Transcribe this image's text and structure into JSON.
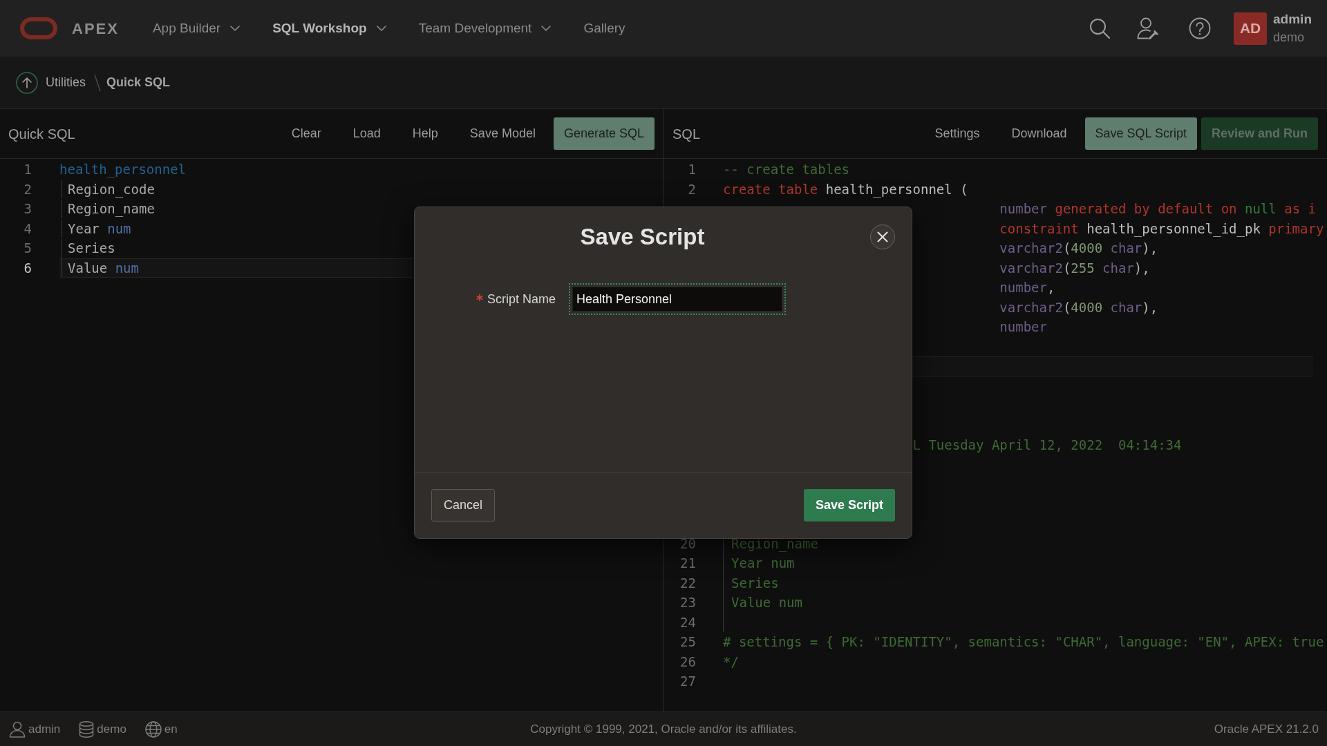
{
  "header": {
    "product": "APEX",
    "nav": [
      {
        "label": "App Builder",
        "selected": false,
        "menu": true
      },
      {
        "label": "SQL Workshop",
        "selected": true,
        "menu": true
      },
      {
        "label": "Team Development",
        "selected": false,
        "menu": true
      },
      {
        "label": "Gallery",
        "selected": false,
        "menu": false
      }
    ],
    "user": {
      "initials": "AD",
      "name": "admin",
      "workspace": "demo"
    }
  },
  "breadcrumb": [
    {
      "label": "Utilities",
      "current": false
    },
    {
      "label": "Quick SQL",
      "current": true
    }
  ],
  "quick_sql_panel": {
    "title": "Quick SQL",
    "buttons": [
      {
        "label": "Clear",
        "kind": "plain"
      },
      {
        "label": "Load",
        "kind": "plain"
      },
      {
        "label": "Help",
        "kind": "plain"
      },
      {
        "label": "Save Model",
        "kind": "plain"
      },
      {
        "label": "Generate SQL",
        "kind": "primary"
      }
    ],
    "editor": {
      "lines": [
        {
          "number": "1",
          "active": false,
          "segments": [
            {
              "text": "health_personnel",
              "kind": "table"
            }
          ],
          "children": [
            {
              "number": "2",
              "active": false,
              "segments": [
                {
                  "text": "Region_code",
                  "kind": "column"
                }
              ]
            },
            {
              "number": "3",
              "active": false,
              "segments": [
                {
                  "text": "Region_name",
                  "kind": "column"
                }
              ]
            },
            {
              "number": "4",
              "active": false,
              "segments": [
                {
                  "text": "Year",
                  "kind": "column"
                },
                {
                  "text": " num",
                  "kind": "datatype"
                }
              ]
            },
            {
              "number": "5",
              "active": false,
              "segments": [
                {
                  "text": "Series",
                  "kind": "column"
                }
              ]
            },
            {
              "number": "6",
              "active": true,
              "segments": [
                {
                  "text": "Value",
                  "kind": "column"
                },
                {
                  "text": " num",
                  "kind": "datatype"
                }
              ]
            }
          ]
        }
      ]
    }
  },
  "sql_panel": {
    "title": "SQL",
    "buttons": [
      {
        "label": "Settings",
        "kind": "plain"
      },
      {
        "label": "Download",
        "kind": "plain"
      },
      {
        "label": "Save SQL Script",
        "kind": "primary"
      },
      {
        "label": "Review and Run",
        "kind": "hot"
      }
    ],
    "editor": {
      "upper_lines": [
        {
          "number": "1",
          "kind": "full",
          "segments": [
            {
              "text": "-- create tables",
              "kind": "comment"
            }
          ]
        },
        {
          "number": "2",
          "kind": "full",
          "segments": [
            {
              "text": "create table",
              "kind": "keyword"
            },
            {
              "text": " health_personnel (",
              "kind": "identifier"
            }
          ]
        },
        {
          "kind": "column",
          "segments": [
            {
              "text": "number",
              "kind": "type"
            },
            {
              "text": " generated by default on",
              "kind": "keyword"
            },
            {
              "text": " null",
              "kind": "literal"
            },
            {
              "text": " as i",
              "kind": "keyword"
            }
          ]
        },
        {
          "kind": "column",
          "segments": [
            {
              "text": "constraint",
              "kind": "keyword"
            },
            {
              "text": " health_personnel_id_pk",
              "kind": "identifier"
            },
            {
              "text": " primary",
              "kind": "keyword"
            }
          ]
        },
        {
          "kind": "column",
          "segments": [
            {
              "text": "varchar2",
              "kind": "type"
            },
            {
              "text": "(",
              "kind": "punct"
            },
            {
              "text": "4000",
              "kind": "number"
            },
            {
              "text": " char",
              "kind": "type"
            },
            {
              "text": "),",
              "kind": "punct"
            }
          ]
        },
        {
          "kind": "column",
          "segments": [
            {
              "text": "varchar2",
              "kind": "type"
            },
            {
              "text": "(",
              "kind": "punct"
            },
            {
              "text": "255",
              "kind": "number"
            },
            {
              "text": " char",
              "kind": "type"
            },
            {
              "text": "),",
              "kind": "punct"
            }
          ]
        },
        {
          "kind": "column",
          "segments": [
            {
              "text": "number",
              "kind": "type"
            },
            {
              "text": ",",
              "kind": "punct"
            }
          ]
        },
        {
          "kind": "column",
          "segments": [
            {
              "text": "varchar2",
              "kind": "type"
            },
            {
              "text": "(",
              "kind": "punct"
            },
            {
              "text": "4000",
              "kind": "number"
            },
            {
              "text": " char",
              "kind": "type"
            },
            {
              "text": "),",
              "kind": "punct"
            }
          ]
        },
        {
          "kind": "column",
          "segments": [
            {
              "text": "number",
              "kind": "type"
            }
          ]
        }
      ],
      "date_line": {
        "segments": [
          {
            "text": "L Tuesday April 12, 2022  04:14:34",
            "kind": "comment"
          }
        ]
      },
      "lower_lines": [
        {
          "number": "20",
          "kind": "indented",
          "segments": [
            {
              "text": "Region_name",
              "kind": "comment"
            }
          ]
        },
        {
          "number": "21",
          "kind": "indented",
          "segments": [
            {
              "text": "Year num",
              "kind": "comment"
            }
          ]
        },
        {
          "number": "22",
          "kind": "indented",
          "segments": [
            {
              "text": "Series",
              "kind": "comment"
            }
          ]
        },
        {
          "number": "23",
          "kind": "indented",
          "segments": [
            {
              "text": "Value num",
              "kind": "comment"
            }
          ]
        },
        {
          "number": "24",
          "kind": "indented"
        },
        {
          "number": "25",
          "kind": "plain",
          "segments": [
            {
              "text": "# settings = { PK: \"IDENTITY\", semantics: \"CHAR\", language: \"EN\", APEX: true",
              "kind": "comment"
            }
          ]
        },
        {
          "number": "26",
          "kind": "plain",
          "segments": [
            {
              "text": "*/",
              "kind": "comment"
            }
          ]
        },
        {
          "number": "27",
          "kind": "plain"
        }
      ]
    }
  },
  "dialog": {
    "title": "Save Script",
    "field": {
      "label": "Script Name",
      "required": true,
      "focused": true,
      "value": "Health Personnel"
    },
    "buttons": [
      {
        "label": "Cancel",
        "kind": "secondary"
      },
      {
        "label": "Save Script",
        "kind": "primary"
      }
    ]
  },
  "footer": {
    "items": [
      {
        "kind": "user",
        "label": "admin"
      },
      {
        "kind": "workspace",
        "label": "demo"
      },
      {
        "kind": "language",
        "label": "en"
      }
    ],
    "copyright": "Copyright © 1999, 2021, Oracle and/or its affiliates.",
    "version": "Oracle APEX 21.2.0"
  }
}
